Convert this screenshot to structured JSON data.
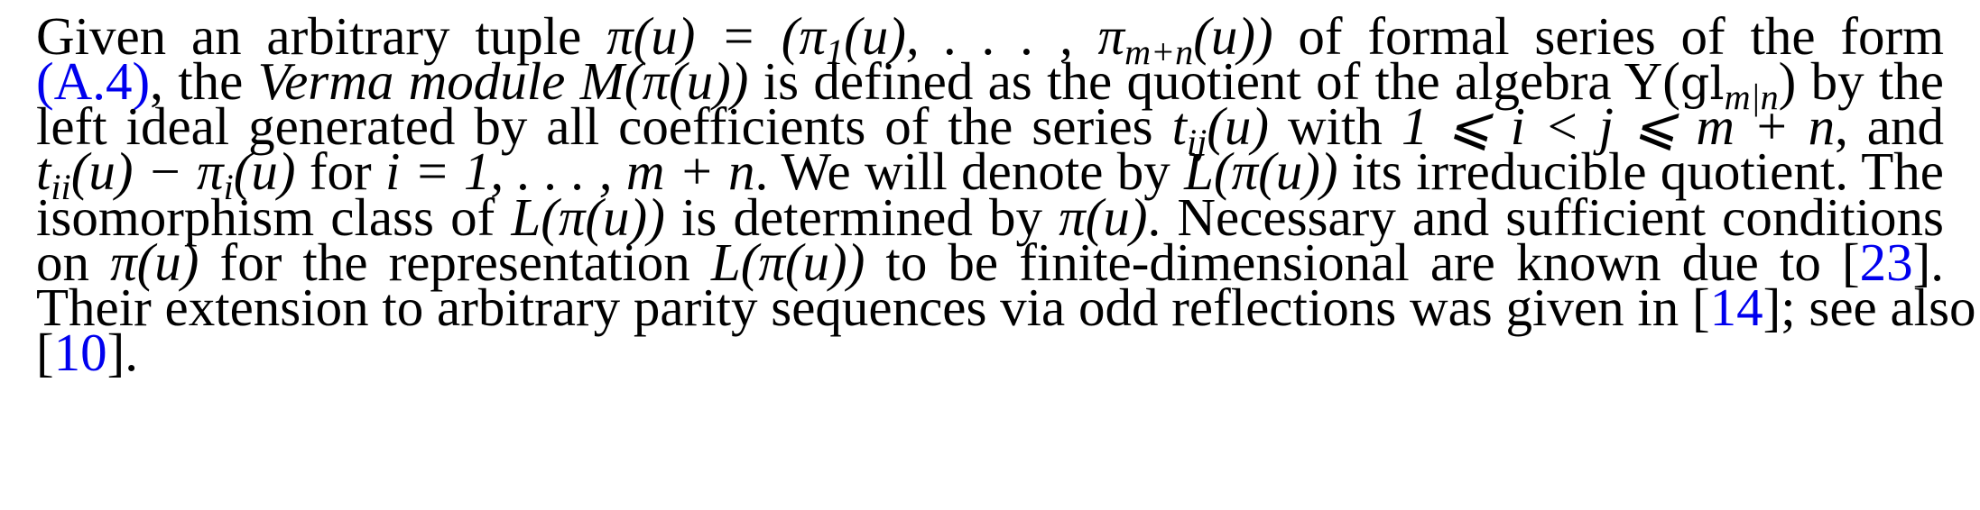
{
  "paragraph": {
    "l1_a": "Given an arbitrary tuple ",
    "l1_math1": "π(u) = (π",
    "l1_sub1": "1",
    "l1_math2": "(u), . . . , π",
    "l1_sub2": "m+n",
    "l1_math3": "(u))",
    "l1_b": " of formal series of the form",
    "l2_ref": "(A.4)",
    "l2_a": ", the ",
    "l2_em": "Verma module",
    "l2_math1": " M(π(u))",
    "l2_b": " is defined as the quotient of the algebra ",
    "l2_math2": "Y(",
    "l2_frak": "gl",
    "l2_sub": "m|n",
    "l2_math3": ")",
    "l2_c": " by the",
    "l3_a": "left ideal generated by all coefficients of the series ",
    "l3_math1": "t",
    "l3_sub1": "ij",
    "l3_math2": "(u)",
    "l3_b": " with ",
    "l3_math3": "1 ⩽ i < j ⩽ m + n",
    "l3_c": ", and",
    "l4_math1": "t",
    "l4_sub1": "ii",
    "l4_math2": "(u) − π",
    "l4_sub2": "i",
    "l4_math3": "(u)",
    "l4_a": " for ",
    "l4_math4": "i = 1, . . . , m + n",
    "l4_b": ". We will denote by ",
    "l4_math5": "L(π(u))",
    "l4_c": " its irreducible quotient. The",
    "l5_a": "isomorphism class of ",
    "l5_math1": "L(π(u))",
    "l5_b": " is determined by ",
    "l5_math2": "π(u)",
    "l5_c": ". Necessary and sufficient conditions",
    "l6_a": "on ",
    "l6_math1": "π(u)",
    "l6_b": " for the representation ",
    "l6_math2": "L(π(u))",
    "l6_c": " to be finite-dimensional are known due to ",
    "l6_cite_open": "[",
    "l6_cite": "23",
    "l6_cite_close": "].",
    "l7_a": "Their extension to arbitrary parity sequences via odd reflections was given in ",
    "l7_cite_open": "[",
    "l7_cite": "14",
    "l7_cite_close": "]; see also",
    "l8_cite_open": "[",
    "l8_cite": "10",
    "l8_cite_close": "]."
  },
  "colors": {
    "text": "#000000",
    "link": "#0000ee",
    "background": "#ffffff"
  }
}
